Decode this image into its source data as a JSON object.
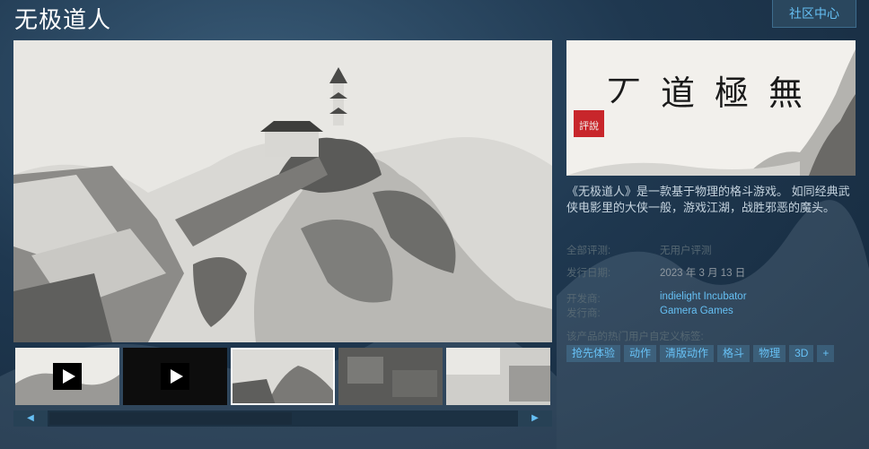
{
  "header": {
    "title": "无极道人",
    "community_button": "社区中心"
  },
  "capsule": {
    "logo_text": "无 极 道 人",
    "seal_text": "東市評說"
  },
  "description": "《无极道人》是一款基于物理的格斗游戏。 如同经典武侠电影里的大侠一般，游戏江湖，战胜邪恶的魔头。",
  "reviews": {
    "label": "全部评测:",
    "value": "无用户评测"
  },
  "release": {
    "label": "发行日期:",
    "value": "2023 年 3 月 13 日"
  },
  "developer": {
    "label": "开发商:",
    "value": "indielight Incubator"
  },
  "publisher": {
    "label": "发行商:",
    "value": "Gamera Games"
  },
  "tags": {
    "label": "该产品的热门用户自定义标签:",
    "items": [
      "抢先体验",
      "动作",
      "清版动作",
      "格斗",
      "物理",
      "3D",
      "+"
    ]
  },
  "thumbnails": [
    {
      "type": "video",
      "icon": "play-icon"
    },
    {
      "type": "video",
      "icon": "play-icon"
    },
    {
      "type": "screenshot",
      "selected": true
    },
    {
      "type": "screenshot"
    },
    {
      "type": "screenshot"
    }
  ],
  "colors": {
    "accent": "#66c0f4",
    "tag_bg": "#2a475e",
    "label": "#556772"
  }
}
